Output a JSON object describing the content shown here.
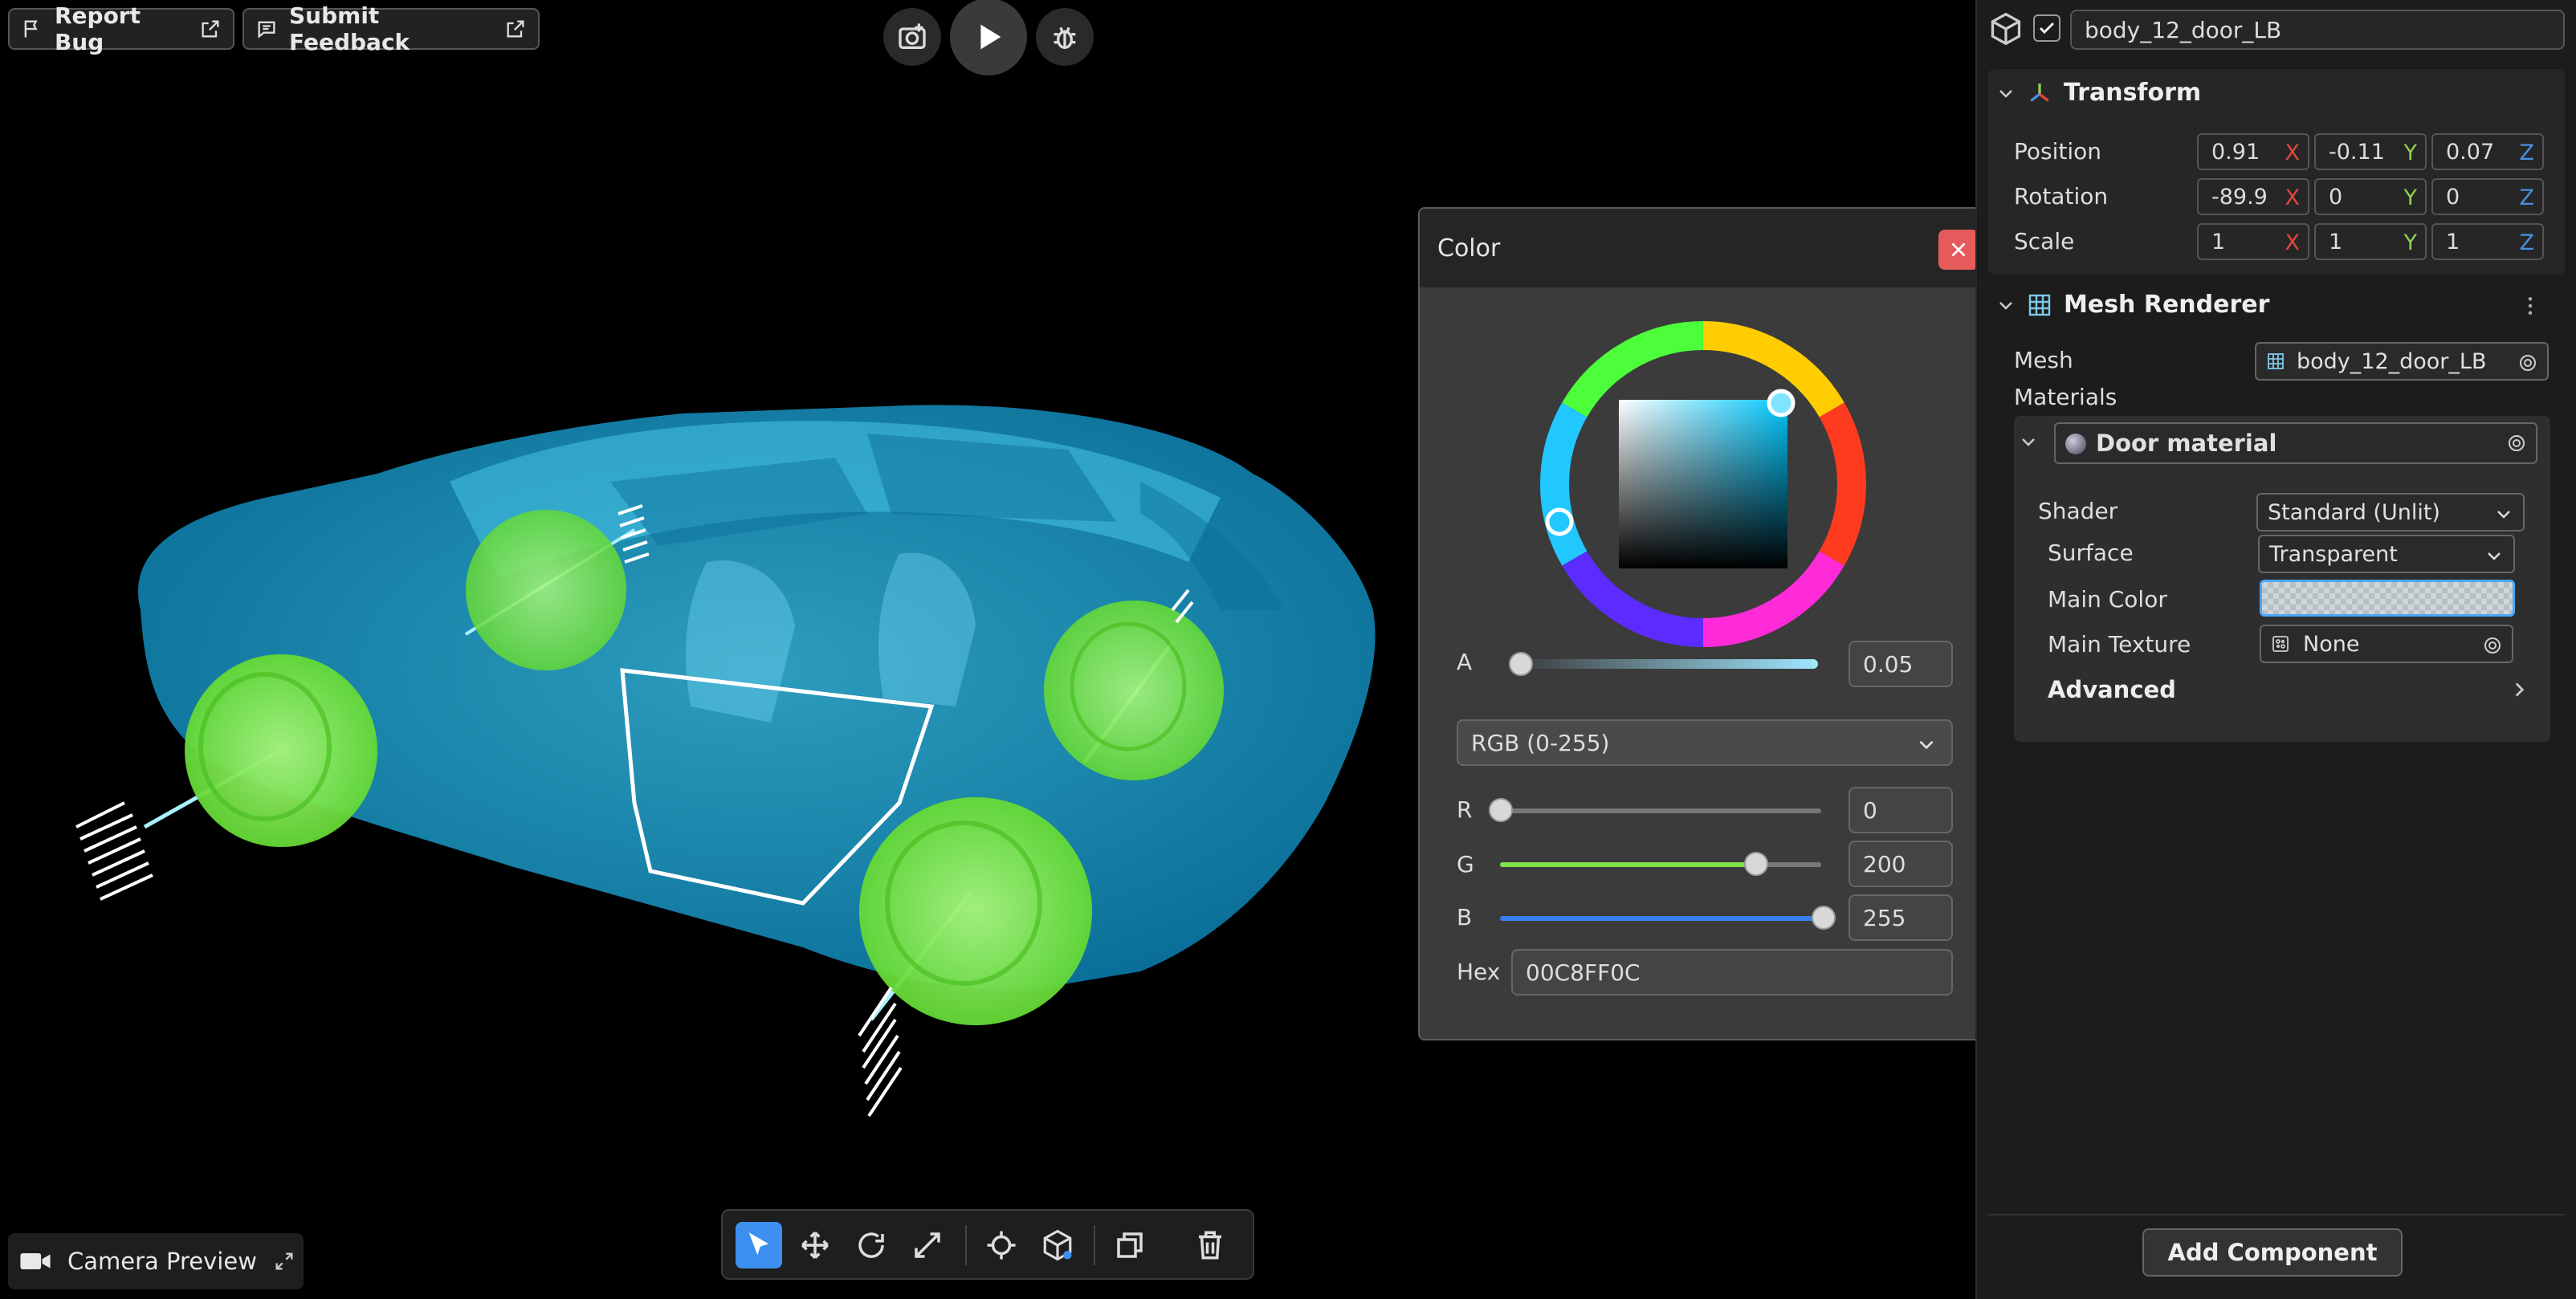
{
  "topbar": {
    "report_bug": "Report Bug",
    "submit_feedback": "Submit Feedback"
  },
  "camera_preview": "Camera Preview",
  "color_dialog": {
    "title": "Color",
    "alpha_label": "A",
    "alpha_value": "0.05",
    "alpha_fraction": 0.05,
    "mode": "RGB (0-255)",
    "r_label": "R",
    "r_value": "0",
    "g_label": "G",
    "g_value": "200",
    "b_label": "B",
    "b_value": "255",
    "hex_label": "Hex",
    "hex_value": "00C8FF0C"
  },
  "inspector": {
    "object_name": "body_12_door_LB",
    "transform": {
      "title": "Transform",
      "position_label": "Position",
      "rotation_label": "Rotation",
      "scale_label": "Scale",
      "position": [
        "0.91",
        "-0.11",
        "0.07"
      ],
      "rotation": [
        "-89.9",
        "0",
        "0"
      ],
      "scale": [
        "1",
        "1",
        "1"
      ],
      "axis_x": "X",
      "axis_y": "Y",
      "axis_z": "Z"
    },
    "mesh_renderer": {
      "title": "Mesh Renderer",
      "mesh_label": "Mesh",
      "mesh_value": "body_12_door_LB",
      "materials_label": "Materials",
      "material_name": "Door material",
      "shader_label": "Shader",
      "shader_value": "Standard (Unlit)",
      "surface_label": "Surface",
      "surface_value": "Transparent",
      "main_color_label": "Main Color",
      "main_texture_label": "Main Texture",
      "main_texture_value": "None",
      "advanced_label": "Advanced"
    },
    "add_component": "Add Component"
  },
  "colors": {
    "car_body": "#1ab4e6",
    "wheels": "#7de84a",
    "axis_x": "#e0483c",
    "axis_y": "#8fd14f",
    "axis_z": "#4a90e2",
    "accent": "#4aa8ff"
  }
}
